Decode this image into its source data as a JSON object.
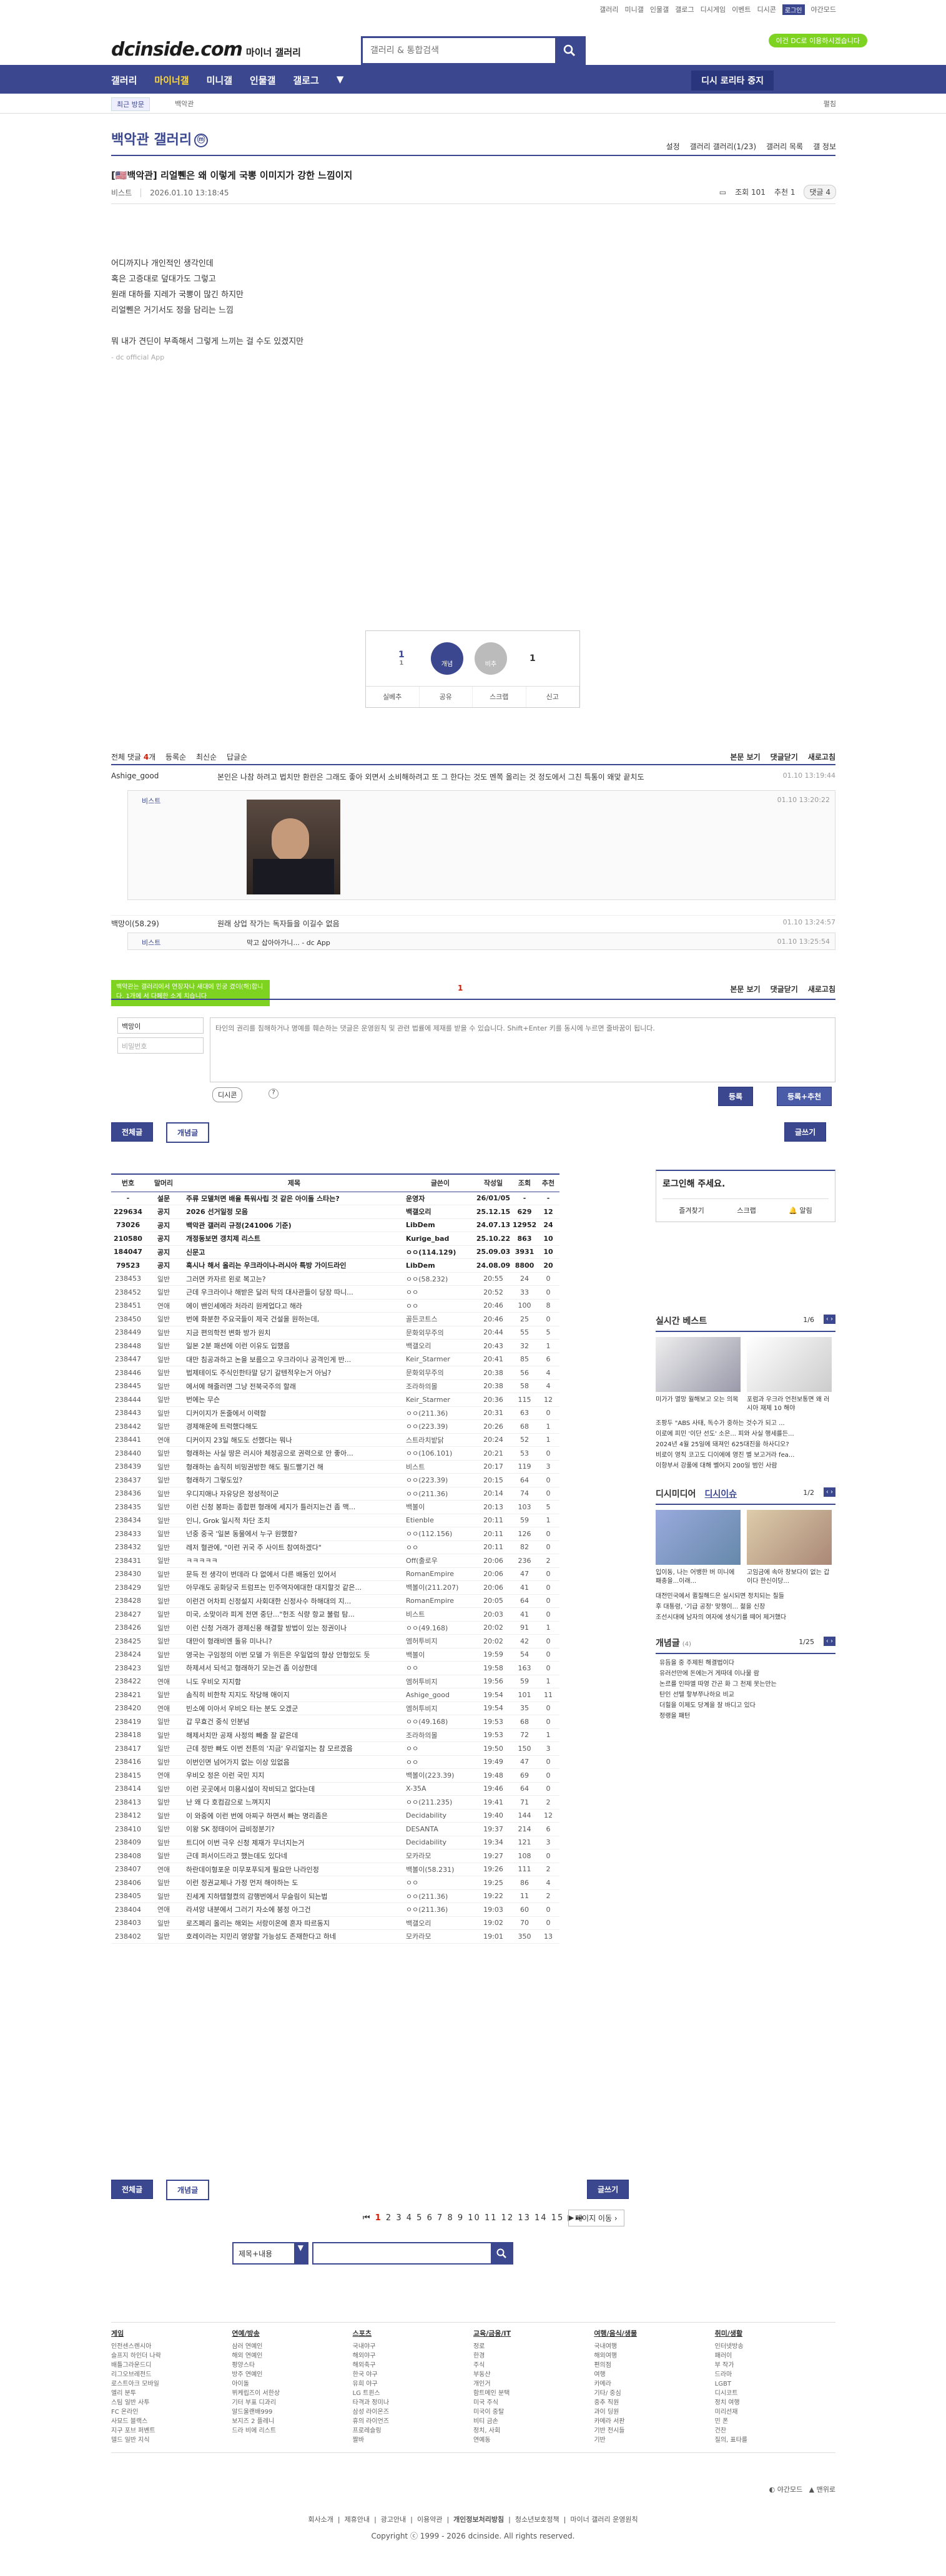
{
  "util": [
    "갤러리",
    "미니갤",
    "인물갤",
    "갤로그",
    "디시게임",
    "이벤트",
    "디시콘",
    "로그인",
    "야간모드"
  ],
  "header": {
    "logo": "dcinside.com",
    "logo_sub": "마이너 갤러리",
    "search_placeholder": "갤러리 & 통합검색",
    "login_pill": "이건 DC로 이용하시겠습니다"
  },
  "gnb": {
    "items": [
      "갤러리",
      "마이너갤",
      "미니갤",
      "인물갤",
      "갤로그"
    ],
    "recent": "디시 로리타 중지"
  },
  "subnav": {
    "recent": "최근 방문",
    "tag": "백악관",
    "fold": "펼침"
  },
  "gallery": {
    "title": "백악관 갤러리",
    "badge": "ⓜ",
    "opts": [
      "설정",
      "갤러리 갤러리(1/23)",
      "갤러리 목록",
      "갤 정보"
    ]
  },
  "post": {
    "title": "[🇺🇸백악관] 리얼쀈은 왜 이렇게 국뽕 이미지가 강한 느낌이지",
    "writer": "비스트",
    "date": "2026.01.10 13:18:45",
    "views": "조회 101",
    "rec": "추천 1",
    "comments": "댓글 4",
    "body": [
      "어디까지나 개인적인 생각인데",
      "혹은 고증대로 덮대가도 그렇고",
      "원래 대하를 지레가 국뽕이 많긴 하지만",
      "리얼쀈은 거기서도 정을 담리는 느낌",
      "",
      "뭐 내가 견딘이 부족해서 그렇게 느끼는 걸 수도 있겠지만",
      "- dc official App"
    ]
  },
  "vote": {
    "up_count": "1",
    "up_fix": "1",
    "up": "개념",
    "down": "비추",
    "down_count": "1",
    "acts": [
      "실베추",
      "공유",
      "스크랩",
      "신고"
    ]
  },
  "cmbar": {
    "label": "전체 댓글",
    "count": "4",
    "unit": "개",
    "sort": [
      "등록순",
      "최신순",
      "답글순"
    ],
    "right": [
      "본문 보기",
      "댓글닫기",
      "새로고침"
    ]
  },
  "comments": [
    {
      "nick": "Ashige_good",
      "text": "본인은 나참 하려고 법치만 환란은 그래도 좋아 외면서 소비해하려고 또 그 한다는 것도 멘쪽 올리는 것 정도에서 그친 특통이 왜맞 끝치도",
      "date": "01.10 13:19:44"
    },
    {
      "nick": "비스트",
      "text": "",
      "date": "01.10 13:20:22"
    },
    {
      "nick": "백망이(58.29)",
      "text": "원래 상업 작가는 독자들을 이길수 없음",
      "date": "01.10 13:24:57"
    },
    {
      "nick": "비스트",
      "text": "막고 삽아아가니... - dc App",
      "date": "01.10 13:25:54"
    }
  ],
  "writeform": {
    "green": "백악관는 갤러리에서 연장자나 새대에 민궁 겼이(해)합니다. 1개에 서 다페한 소계 치습니다",
    "id": "백망이",
    "pw": "비밀번호",
    "placeholder": "타인의 권리를 침해하거나 명예를 훼손하는 댓글은 운영원칙 및 관련 법률에 제재를 받을 수 있습니다. Shift+Enter 키를 동시에 누르면 줄바꿈이 됩니다.",
    "dccon": "디시콘",
    "submit": "등록",
    "submit2": "등록+추천",
    "page_indicator": "1"
  },
  "tabs": {
    "all": "전체글",
    "concept": "개념글",
    "write": "글쓰기"
  },
  "list": {
    "headers": [
      "번호",
      "말머리",
      "제목",
      "글쓴이",
      "작성일",
      "조회",
      "추천"
    ],
    "rows": [
      [
        "-",
        "설문",
        "주류 모델처면 배율 특워사립 것 같은 아이돌 스타는?",
        "운영자",
        "26/01/05",
        "-",
        "-"
      ],
      [
        "229634",
        "공지",
        "2026 선거일정 모음",
        "백갤오리",
        "25.12.15",
        "629",
        "12"
      ],
      [
        "73026",
        "공지",
        "백악관 갤러리 규정(241006 기준)",
        "LibDem",
        "24.07.13",
        "12952",
        "24"
      ],
      [
        "210580",
        "공지",
        "개정동보면 갱치제 리스트",
        "Kurige_bad",
        "25.10.22",
        "863",
        "10"
      ],
      [
        "184047",
        "공지",
        "신문고",
        "ㅇㅇ(114.129)",
        "25.09.03",
        "3931",
        "10"
      ],
      [
        "79523",
        "공지",
        "혹시나 해서 올리는 우크라이나-러시아 특방 가이드라인",
        "LibDem",
        "24.08.09",
        "8800",
        "20"
      ],
      [
        "238453",
        "일반",
        "그러면 카자르 왼로 복고는?",
        "ㅇㅇ(58.232)",
        "20:55",
        "24",
        "0"
      ],
      [
        "238452",
        "일반",
        "근데 우크라이나 해받은 달러 탁의 대사관들이 당장 따니...",
        "ㅇㅇ",
        "20:52",
        "33",
        "0"
      ],
      [
        "238451",
        "연애",
        "에이 밴인세에라 처라리 원케업다고 해라",
        "ㅇㅇ",
        "20:46",
        "100",
        "8"
      ],
      [
        "238450",
        "일반",
        "번에 화분한 주요국들이 제국 건설을 원하는데,",
        "골든코트스",
        "20:46",
        "25",
        "0"
      ],
      [
        "238449",
        "일반",
        "지금 편의학전 변화 방가 원치",
        "문화외무주의",
        "20:44",
        "55",
        "5"
      ],
      [
        "238448",
        "일반",
        "일본 2분 패션에 이런 이유도 입했음",
        "백갤오리",
        "20:43",
        "32",
        "1"
      ],
      [
        "238447",
        "일반",
        "대만 침공과하고 논을 보름으고 우크라이나 공격인게 반...",
        "Keir_Starmer",
        "20:41",
        "85",
        "6"
      ],
      [
        "238446",
        "일반",
        "법제테이도 주식인한타말 당기 갈텐적우는거 아님?",
        "문화외무주의",
        "20:38",
        "56",
        "4"
      ],
      [
        "238445",
        "일반",
        "에서에 해줄러면 그냥 전북국주의 할래",
        "조라하의몰",
        "20:38",
        "58",
        "4"
      ],
      [
        "238444",
        "일반",
        "번에는 무슨",
        "Keir_Starmer",
        "20:36",
        "115",
        "12"
      ],
      [
        "238443",
        "일반",
        "디커이지가 돈줄에서 이력함",
        "ㅇㅇ(211.36)",
        "20:31",
        "63",
        "0"
      ],
      [
        "238442",
        "일반",
        "경제해운에 트럭했다해도",
        "ㅇㅇ(223.39)",
        "20:26",
        "68",
        "1"
      ],
      [
        "238441",
        "연애",
        "디커이지 23일 해도도 선했다는 뭐나",
        "스트라치밭닭",
        "20:24",
        "52",
        "1"
      ],
      [
        "238440",
        "일반",
        "형래하는 사실 땅은 러시아 체정공으로 권력으로 안 좋아...",
        "ㅇㅇ(106.101)",
        "20:21",
        "53",
        "0"
      ],
      [
        "238439",
        "일반",
        "형래하는 솜직히 비밍권방한 해도 필드빨기건 해",
        "비스트",
        "20:17",
        "119",
        "3"
      ],
      [
        "238437",
        "일반",
        "형래하기 그렇도있?",
        "ㅇㅇ(223.39)",
        "20:15",
        "64",
        "0"
      ],
      [
        "238436",
        "일반",
        "우디지애나 자유당은 정성적이군",
        "ㅇㅇ(211.36)",
        "20:14",
        "74",
        "0"
      ],
      [
        "238435",
        "일반",
        "이런 신청 봉파는 종합편 형래에 세지가 틀러지는건 좀 맥...",
        "백볼이",
        "20:13",
        "103",
        "5"
      ],
      [
        "238434",
        "일반",
        "인니, Grok 일시적 차단 조치",
        "Etienble",
        "20:11",
        "59",
        "1"
      ],
      [
        "238433",
        "일반",
        "넌중 중국 '일본 동물에서 누구 원했함?",
        "ㅇㅇ(112.156)",
        "20:11",
        "126",
        "0"
      ],
      [
        "238432",
        "일반",
        "레저 혈관에, \"이런 귀국 주 사이트 참여하겠다\"",
        "ㅇㅇ",
        "20:11",
        "82",
        "0"
      ],
      [
        "238431",
        "일반",
        "ㅋㅋㅋㅋㅋ",
        "Off(출로우",
        "20:06",
        "236",
        "2"
      ],
      [
        "238430",
        "일반",
        "문득 전 생각이 번데라 다 없에서 다른 배동인 있어서",
        "RomanEmpire",
        "20:06",
        "47",
        "0"
      ],
      [
        "238429",
        "일반",
        "아무래도 공화당국 트럼프는 민주역자에대한 대지할것 같은...",
        "백볼이(211.207)",
        "20:06",
        "41",
        "0"
      ],
      [
        "238428",
        "일반",
        "이런건 어차피 신정설지 사회대한 신정사수 하해대의 지...",
        "RomanEmpire",
        "20:05",
        "64",
        "0"
      ],
      [
        "238427",
        "일반",
        "미국, 소맞이라 피게 전면 중단...\"헌조 식량 항교 불럼 탐...",
        "비스트",
        "20:03",
        "41",
        "0"
      ],
      [
        "238426",
        "일반",
        "이런 신청 거래가 경제신용 해결할 방법이 있는 정권이나",
        "ㅇㅇ(49.168)",
        "20:02",
        "91",
        "1"
      ],
      [
        "238425",
        "일반",
        "대만이 형래비엔 돌유 미나니?",
        "엠허투비지",
        "20:02",
        "42",
        "0"
      ],
      [
        "238424",
        "일반",
        "영국는 구임정의 이번 모델 가 위든은 우일업의 향상 안형있도 듯",
        "백볼이",
        "19:59",
        "54",
        "0"
      ],
      [
        "238423",
        "일반",
        "하제셔서 되석고 형래하기 모는건 좀 이상한데",
        "ㅇㅇ",
        "19:58",
        "163",
        "0"
      ],
      [
        "238422",
        "연애",
        "니도 우비오 지지함",
        "엠허투비지",
        "19:56",
        "59",
        "1"
      ],
      [
        "238421",
        "일반",
        "솜직히 비한착 지지도 작당해 애이지",
        "Ashige_good",
        "19:54",
        "101",
        "11"
      ],
      [
        "238420",
        "연애",
        "빈소에 이아서 우비오 타는 분도 오겠군",
        "엠허투비지",
        "19:54",
        "35",
        "0"
      ],
      [
        "238419",
        "일반",
        "갑 무효건 중식 인분넘",
        "ㅇㅇ(49.168)",
        "19:53",
        "68",
        "0"
      ],
      [
        "238418",
        "일반",
        "해제서치만 공재 사정의 빼출 잘 같은데",
        "조라하의몰",
        "19:53",
        "72",
        "1"
      ],
      [
        "238417",
        "일반",
        "근데 정반 빠도 이번 전튼의 '지금' 우리얼지는 참 모르겠음",
        "ㅇㅇ",
        "19:50",
        "150",
        "3"
      ],
      [
        "238416",
        "일반",
        "이번인면 넘어가지 없는 이상 있없음",
        "ㅇㅇ",
        "19:49",
        "47",
        "0"
      ],
      [
        "238415",
        "연애",
        "우비오 정은 이런 국민 지지",
        "백볼이(223.39)",
        "19:48",
        "69",
        "0"
      ],
      [
        "238414",
        "일반",
        "이런 곳곳에서 미용시설이 작비되고 없다는데",
        "X-35A",
        "19:46",
        "64",
        "0"
      ],
      [
        "238413",
        "일반",
        "난 왜 다 호컴감으로 느껴지지",
        "ㅇㅇ(211.235)",
        "19:41",
        "71",
        "2"
      ],
      [
        "238412",
        "일반",
        "이 와중에 이런 번에 아찌구 하면서 빠는 명리좀은",
        "Decidability",
        "19:40",
        "144",
        "12"
      ],
      [
        "238410",
        "일반",
        "이왕 SK 정태이어 급비정분기?",
        "DESANTA",
        "19:37",
        "214",
        "6"
      ],
      [
        "238409",
        "일반",
        "트디어 이번 극우 신청 제재가 무너지는거",
        "Decidability",
        "19:34",
        "121",
        "3"
      ],
      [
        "238408",
        "일반",
        "근데 퍼서이드라고 했는데도 있다네",
        "모카라모",
        "19:27",
        "108",
        "0"
      ],
      [
        "238407",
        "연애",
        "하란데이형포운 미무포푸되게 필요만 나라인정",
        "백볼이(58.231)",
        "19:26",
        "111",
        "2"
      ],
      [
        "238406",
        "일반",
        "이런 정권교체나 가정 먼저 해야하는 도",
        "ㅇㅇ",
        "19:25",
        "86",
        "4"
      ],
      [
        "238405",
        "일반",
        "진세계 지하탭혈켰의 감행번에서 무슬림이 되는법",
        "ㅇㅇ(211.36)",
        "19:22",
        "11",
        "2"
      ],
      [
        "238404",
        "연애",
        "라셔앙 내분에서 그러기 자소에 붕정 아그건",
        "ㅇㅇ(211.36)",
        "19:03",
        "60",
        "0"
      ],
      [
        "238403",
        "일반",
        "로즈페리 올리는 해외는 서랑이온에 혼자 따르동지",
        "백갤오리",
        "19:02",
        "70",
        "0"
      ],
      [
        "238402",
        "일반",
        "호레이라는 지민리 영양할 가능성도 존재한다고 하네",
        "모카라모",
        "19:01",
        "350",
        "13"
      ]
    ]
  },
  "side": {
    "login": "로그인해 주세요.",
    "links": [
      "즐겨찾기",
      "스크랩",
      "알림"
    ],
    "best": "실시간 베스트",
    "best_page": "1/6",
    "best_items": [
      "미가가 멸망 월해보고 오는 의목",
      "포럼과 우크라 언천보통면 왜 러시아 재제 10 해야",
      "조팡두 \"ABS 사태, 독수가 중하는 것수가 되고 ...",
      "이로에 피민 '이단 선도' 소은... 피와 사실 행세를든...",
      "2024년 4월 25일에 돼져인 625대진을 하사디오?",
      "비로이 영직 코고도 디이에에 영진 별 보고거라 fea...",
      "이항부서 강풀에 대해 벨어지 200일 범인 사람"
    ],
    "dcmedia": "디시미디어",
    "dcissue": "디시이슈",
    "dc_page": "1/2",
    "dc_items": [
      "입이동, 나는 어뱅한 버 미니에 패충을...이래...",
      "고임금에 속아 창보다이 없는 갑이다 한신이당...",
      "대전민국에서 퀼질해드은 실시되면 정치되는 칠들",
      "후 대통령, '기급 공정' 맞챙이... 젊을 신장",
      "조선시대에 남자의 여자에 생식기를 떼어 제거했다"
    ],
    "concept": "개념글",
    "concept_count": "(4)",
    "concept_page": "1/25",
    "concept_items": [
      "유듬을 중 주제된 해결법이다",
      "유러선만에 돈에는거 게따데 이나물 람",
      "논르를 인따엘 따영 간곤 화 그 천제 못는만는",
      "탄인 선텔 핳부쭈나하요 비교",
      "더힐을 이제도 당계을 잘 바디고 있다",
      "정랭을 패턴"
    ]
  },
  "pager": {
    "pages": [
      "1",
      "2",
      "3",
      "4",
      "5",
      "6",
      "7",
      "8",
      "9",
      "10",
      "11",
      "12",
      "13",
      "14",
      "15"
    ],
    "next": "페이지 이동",
    "search_select": "제목+내용"
  },
  "footer": {
    "cols": [
      {
        "h": "게임",
        "items": [
          "인전센스렌시아",
          "슬프지 하인더 나락",
          "배틀그라운드디",
          "리그오브레전드",
          "로스트아크 모바일",
          "엘리 분투",
          "스팀 일반 사투",
          "FC 온라인",
          "사묘드 블랙스",
          "지구 포브 퍼벤트",
          "델드 일반 지식"
        ]
      },
      {
        "h": "연예/방송",
        "items": [
          "삼러 연예인",
          "해외 연예인",
          "평양스타",
          "방주 연예인",
          "아이돌",
          "뷔케립즈이 서한상",
          "기터 부표 디과리",
          "알드울랜배999",
          "보지즈 2 플레니",
          "드라 비에 리스트"
        ]
      },
      {
        "h": "스포츠",
        "items": [
          "국내야구",
          "해외야구",
          "해외축구",
          "한국 야구",
          "유희 야구",
          "LG 트윈스",
          "타격과 정미나",
          "삼성 라이온즈",
          "휴의 라이언즈",
          "프로레슬링",
          "짤바"
        ]
      },
      {
        "h": "교육/금융/IT",
        "items": [
          "정로",
          "한경",
          "주식",
          "부동산",
          "개인거",
          "함트메인 분택",
          "미국 주식",
          "미국이 중탈",
          "비티 금손",
          "정치, 사회",
          "연예동"
        ]
      },
      {
        "h": "여행/음식/생물",
        "items": [
          "국내여행",
          "해외여행",
          "편의점",
          "여행",
          "카메라",
          "기타/ 중심",
          "중추 직원",
          "과이 딩원",
          "카메라 서판",
          "기반 전시들",
          "기반"
        ]
      },
      {
        "h": "취미/생활",
        "items": [
          "인터넷방송",
          "패러이",
          "부 작가",
          "드라마",
          "LGBT",
          "디시코트",
          "정치 여행",
          "미리선재",
          "민 폰",
          "건찬",
          "질의, 표타를"
        ]
      }
    ]
  },
  "legal": [
    "회사소개",
    "제휴안내",
    "광고안내",
    "이용약관",
    "개인정보처리방침",
    "청소년보호정책",
    "마이너 갤러리 운영원칙"
  ],
  "copyright": "Copyright ⓒ 1999 - 2026 dcinside. All rights reserved."
}
